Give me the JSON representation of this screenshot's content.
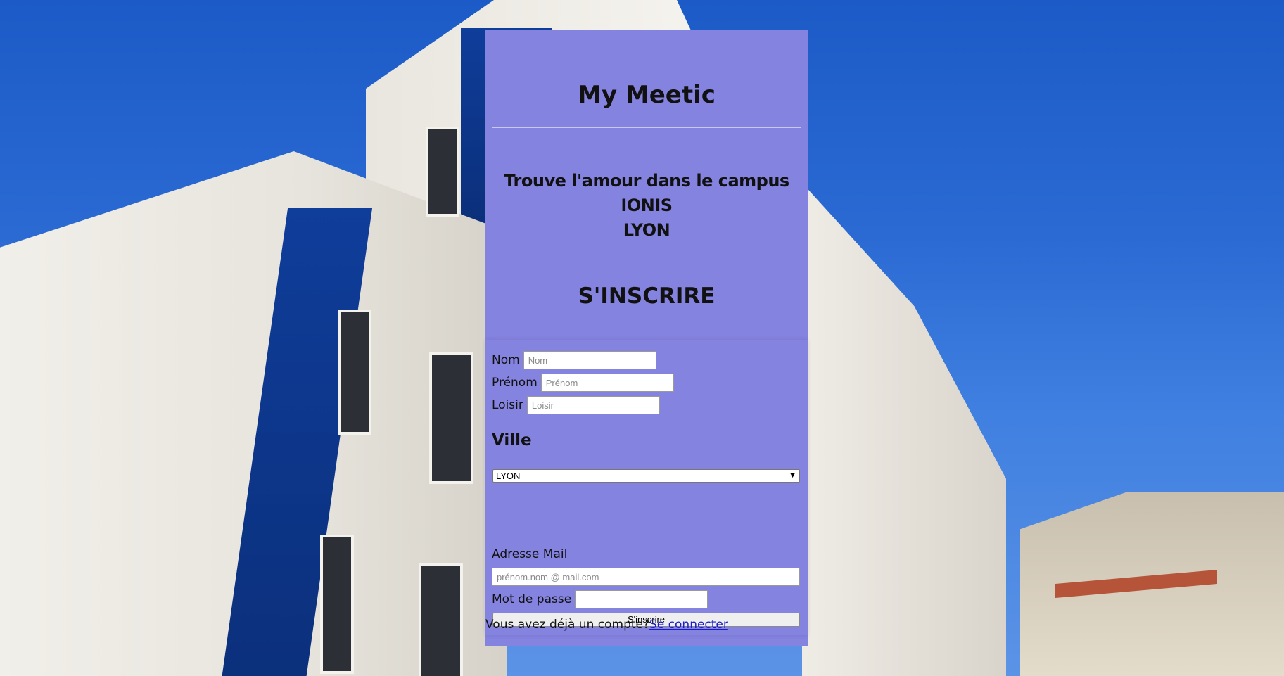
{
  "header": {
    "title": "My Meetic",
    "subtitle_line1": "Trouve l'amour dans le campus IONIS",
    "subtitle_line2": "LYON",
    "section_title": "S'INSCRIRE"
  },
  "form": {
    "nom_label": "Nom",
    "nom_placeholder": "Nom",
    "prenom_label": "Prénom",
    "prenom_placeholder": "Prénom",
    "loisir_label": "Loisir",
    "loisir_placeholder": "Loisir",
    "ville_title": "Ville",
    "ville_selected": "LYON",
    "mail_label": "Adresse Mail",
    "mail_placeholder": "prénom.nom @ mail.com",
    "password_label": "Mot de passe",
    "submit_label": "S'inscrire"
  },
  "footer": {
    "text": "Vous avez déjà un compte?",
    "link": "Se connecter"
  },
  "colors": {
    "panel_bg": "#8583e0",
    "link": "#1a1acc"
  },
  "icons": {
    "select_arrow": "chevron-down-icon"
  }
}
